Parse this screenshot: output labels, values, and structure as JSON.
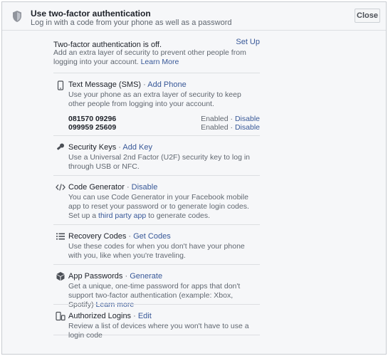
{
  "header": {
    "title": "Use two-factor authentication",
    "subtitle": "Log in with a code from your phone as well as a password",
    "close_label": "Close"
  },
  "status": {
    "text": "Two-factor authentication is off.",
    "setup_label": "Set Up",
    "description": "Add an extra layer of security to prevent other people from logging into your account.",
    "learn_more": "Learn More"
  },
  "methods": {
    "sms": {
      "title": "Text Message (SMS)",
      "separator": " · ",
      "action": "Add Phone",
      "description": "Use your phone as an extra layer of security to keep other people from logging into your account.",
      "phones": [
        {
          "number": "081570 09296",
          "status": "Enabled",
          "sep": " · ",
          "action": "Disable"
        },
        {
          "number": "099959 25609",
          "status": "Enabled",
          "sep": " · ",
          "action": "Disable"
        }
      ]
    },
    "keys": {
      "title": "Security Keys",
      "separator": " · ",
      "action": "Add Key",
      "description": "Use a Universal 2nd Factor (U2F) security key to log in through USB or NFC."
    },
    "codegen": {
      "title": "Code Generator",
      "separator": " · ",
      "action": "Disable",
      "description_pre": "You can use Code Generator in your Facebook mobile app to reset your password or to generate login codes. Set up a ",
      "description_link": "third party app",
      "description_post": " to generate codes."
    },
    "recovery": {
      "title": "Recovery Codes",
      "separator": " · ",
      "action": "Get Codes",
      "description": "Use these codes for when you don't have your phone with you, like when you're traveling."
    },
    "apppw": {
      "title": "App Passwords",
      "separator": " · ",
      "action": "Generate",
      "description_pre": "Get a unique, one-time password for apps that don't support two-factor authentication (example: Xbox, Spotify) ",
      "description_link": "Learn more"
    },
    "logins": {
      "title": "Authorized Logins",
      "separator": " · ",
      "action": "Edit",
      "description": "Review a list of devices where you won't have to use a login code"
    }
  },
  "icons": {
    "header": "shield-icon",
    "sms": "mobile-phone-icon",
    "keys": "security-key-icon",
    "codegen": "code-icon",
    "recovery": "list-icon",
    "apppw": "cube-icon",
    "logins": "devices-icon"
  },
  "colors": {
    "link": "#385898",
    "muted": "#606770",
    "text": "#1d2129",
    "background": "#f6f7f9",
    "divider": "#dddfe2"
  }
}
